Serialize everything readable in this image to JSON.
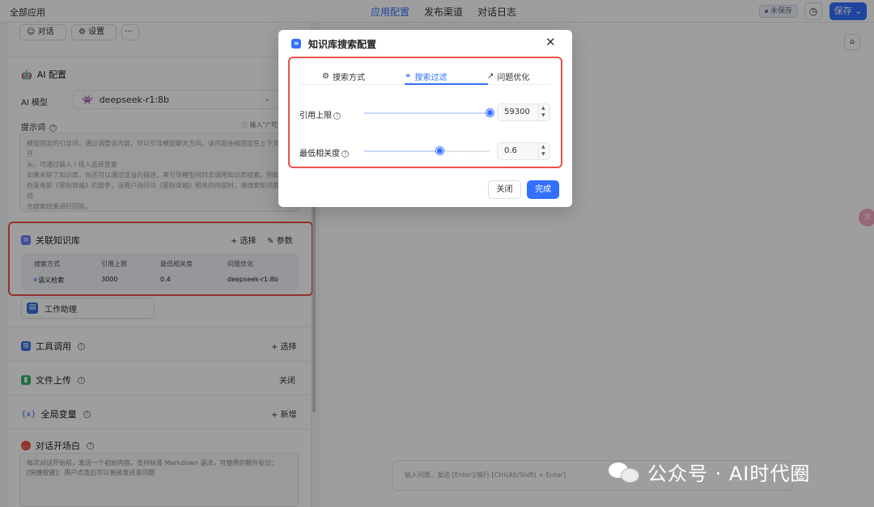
{
  "topbar": {
    "all_apps": "全部应用",
    "tabs": [
      "应用配置",
      "发布渠道",
      "对话日志"
    ],
    "unsaved": "未保存",
    "save": "保存"
  },
  "left": {
    "chat_chip": "对话",
    "settings_chip": "设置",
    "more_chip": "···",
    "ai_config_title": "AI 配置",
    "ai_model_label": "AI 模型",
    "ai_model_value": "deepseek-r1:8b",
    "prompt_label": "提示词",
    "prompt_hint": "输入\"/\"可选",
    "prompt_placeholder_1": "模型固定的引导词，通过调整该内容，可以引导模型聊天方向。该内容会被固定在上下文的开",
    "prompt_placeholder_2": "头。可通过输入 / 插入选择变量",
    "prompt_placeholder_3": "如果关联了知识库，你还可以通过适当的描述，来引导模型何时去调用知识库搜索。例如：",
    "prompt_placeholder_4": "你是电影《星际穿越》的助手，当用户询问与《星际穿越》相关的内容时，请搜索知识库并结",
    "prompt_placeholder_5": "合搜索结果进行回答。",
    "kb_title": "关联知识库",
    "kb_select": "+ 选择",
    "kb_params": "参数",
    "kb_headers": [
      "搜索方式",
      "引用上限",
      "最低相关度",
      "问题优化"
    ],
    "kb_row": [
      "语义检索",
      "3000",
      "0.4",
      "deepseek-r1:8b"
    ],
    "assistant_label": "工作助理",
    "tools_title": "工具调用",
    "tools_action": "+ 选择",
    "upload_title": "文件上传",
    "upload_action": "关闭",
    "vars_title": "全局变量",
    "vars_action": "+ 新增",
    "opening_title": "对话开场白",
    "opening_placeholder_1": "每次对话开始前，发送一个初始内容。支持标准 Markdown 语法，可使用的额外标记：",
    "opening_placeholder_2": "[快捷按键]：用户点击后可以直接发送该问题"
  },
  "chat_input_placeholder": "输入问题，发送 [Enter]/换行 [Ctrl(Alt/Shift) + Enter]",
  "modal": {
    "title": "知识库搜索配置",
    "tabs": [
      "搜索方式",
      "搜索过滤",
      "问题优化"
    ],
    "active_tab": 1,
    "limit_label": "引用上限",
    "limit_value": "59300",
    "limit_fraction": 1.0,
    "similarity_label": "最低相关度",
    "similarity_value": "0.6",
    "similarity_fraction": 0.6,
    "cancel": "关闭",
    "confirm": "完成"
  },
  "watermark": "公众号 · AI时代圈",
  "colors": {
    "accent": "#3370ff",
    "highlight_border": "#e8534a"
  }
}
